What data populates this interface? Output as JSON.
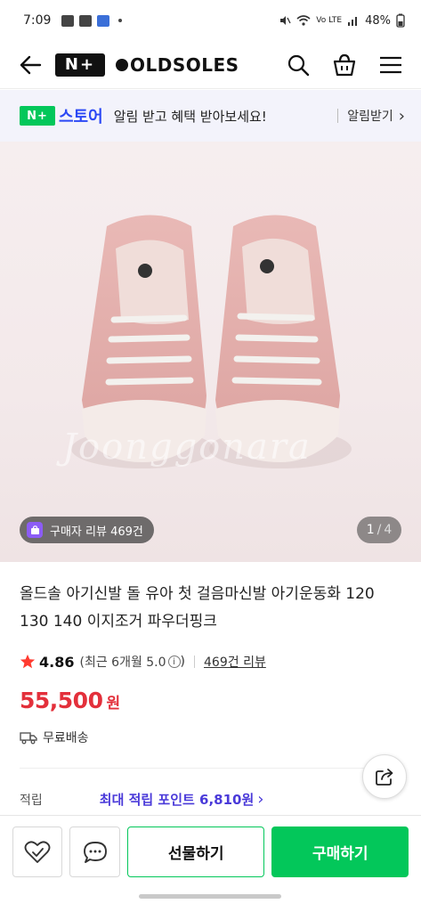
{
  "status_bar": {
    "time": "7:09",
    "battery": "48%",
    "network": "Vo LTE"
  },
  "header": {
    "plus_badge": "N+",
    "brand": "OLDSOLES"
  },
  "notify_banner": {
    "badge": "N+",
    "store_text": "스토어",
    "message": "알림 받고 혜택 받아보세요!",
    "button_label": "알림받기",
    "button_chevron": "›"
  },
  "gallery": {
    "review_badge": "구매자 리뷰 469건",
    "current_page": "1",
    "separator": "/",
    "total_pages": "4",
    "watermark": "Joonggonara"
  },
  "product": {
    "title": "올드솔 아기신발 돌 유아 첫 걸음마신발 아기운동화 120 130 140 이지조거 파우더핑크",
    "rating": "4.86",
    "rating_recent": "(최근 6개월 5.0",
    "rating_recent_close": ")",
    "info_glyph": "i",
    "review_count": "469건 리뷰",
    "price": "55,500",
    "currency": "원",
    "shipping": "무료배송",
    "points_label": "적립",
    "points_value": "최대 적립 포인트 6,810원",
    "points_chevron": "›"
  },
  "bottom_bar": {
    "gift_label": "선물하기",
    "buy_label": "구매하기"
  },
  "colors": {
    "accent_green": "#03c75a",
    "price_red": "#e3303b",
    "store_blue": "#2b48f5",
    "points_purple": "#4a3ad9"
  }
}
